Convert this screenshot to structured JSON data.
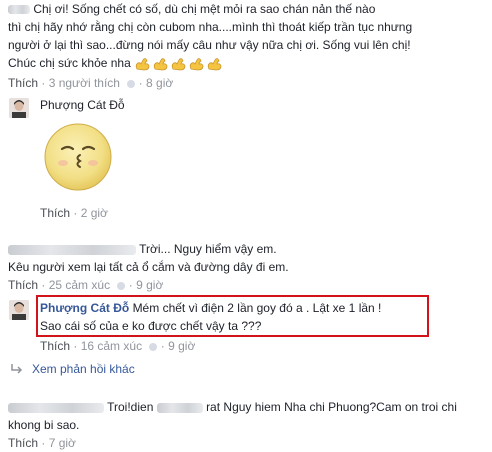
{
  "comment1": {
    "lines": [
      "Chị ơi! Sống chết có số, dù chị mệt mỏi ra sao chán nản thế nào",
      "thì chị hãy nhớ rằng chị còn cubom nha....mình thì thoát kiếp trần tục nhưng",
      "người ở lại thì sao...đừng nói mấy câu như vậy nữa chị ơi. Sống vui lên chị!",
      "Chúc chị sức khỏe nha"
    ],
    "emoji_count": 5,
    "emoji_icon": "flexed-biceps-icon",
    "like_label": "Thích",
    "likes_count": "3 người thích",
    "time": "8 giờ"
  },
  "reply1": {
    "author": "Phượng Cát Đỗ",
    "sticker_icon": "kiss-face-sticker-icon",
    "like_label": "Thích",
    "time": "2 giờ"
  },
  "comment2": {
    "line1": "Trời... Nguy hiểm vậy em.",
    "line2": "Kêu người xem lại tất cả ổ cắm và đường dây đi em.",
    "like_label": "Thích",
    "reactions": "25 cảm xúc",
    "time": "9 giờ"
  },
  "reply2": {
    "author": "Phượng Cát Đỗ",
    "text1": "Mém chết vì điện 2 lần goy đó a . Lật xe 1 lần !",
    "text2": "Sao cái số của e ko được chết vậy ta ???",
    "like_label": "Thích",
    "reactions": "16 cảm xúc",
    "time": "9 giờ",
    "highlight_color": "#d1141a"
  },
  "more_replies": {
    "label": "Xem phản hồi khác",
    "icon": "reply-arrow-icon"
  },
  "comment3": {
    "text1a": "Troi!dien",
    "text1b": "rat Nguy hiem Nha chi Phuong?Cam on troi chi",
    "line2": "khong bi sao.",
    "like_label": "Thích",
    "time": "7 giờ"
  },
  "colors": {
    "name_blue": "#365899",
    "meta_gray": "#90949c",
    "text": "#1d2129"
  }
}
